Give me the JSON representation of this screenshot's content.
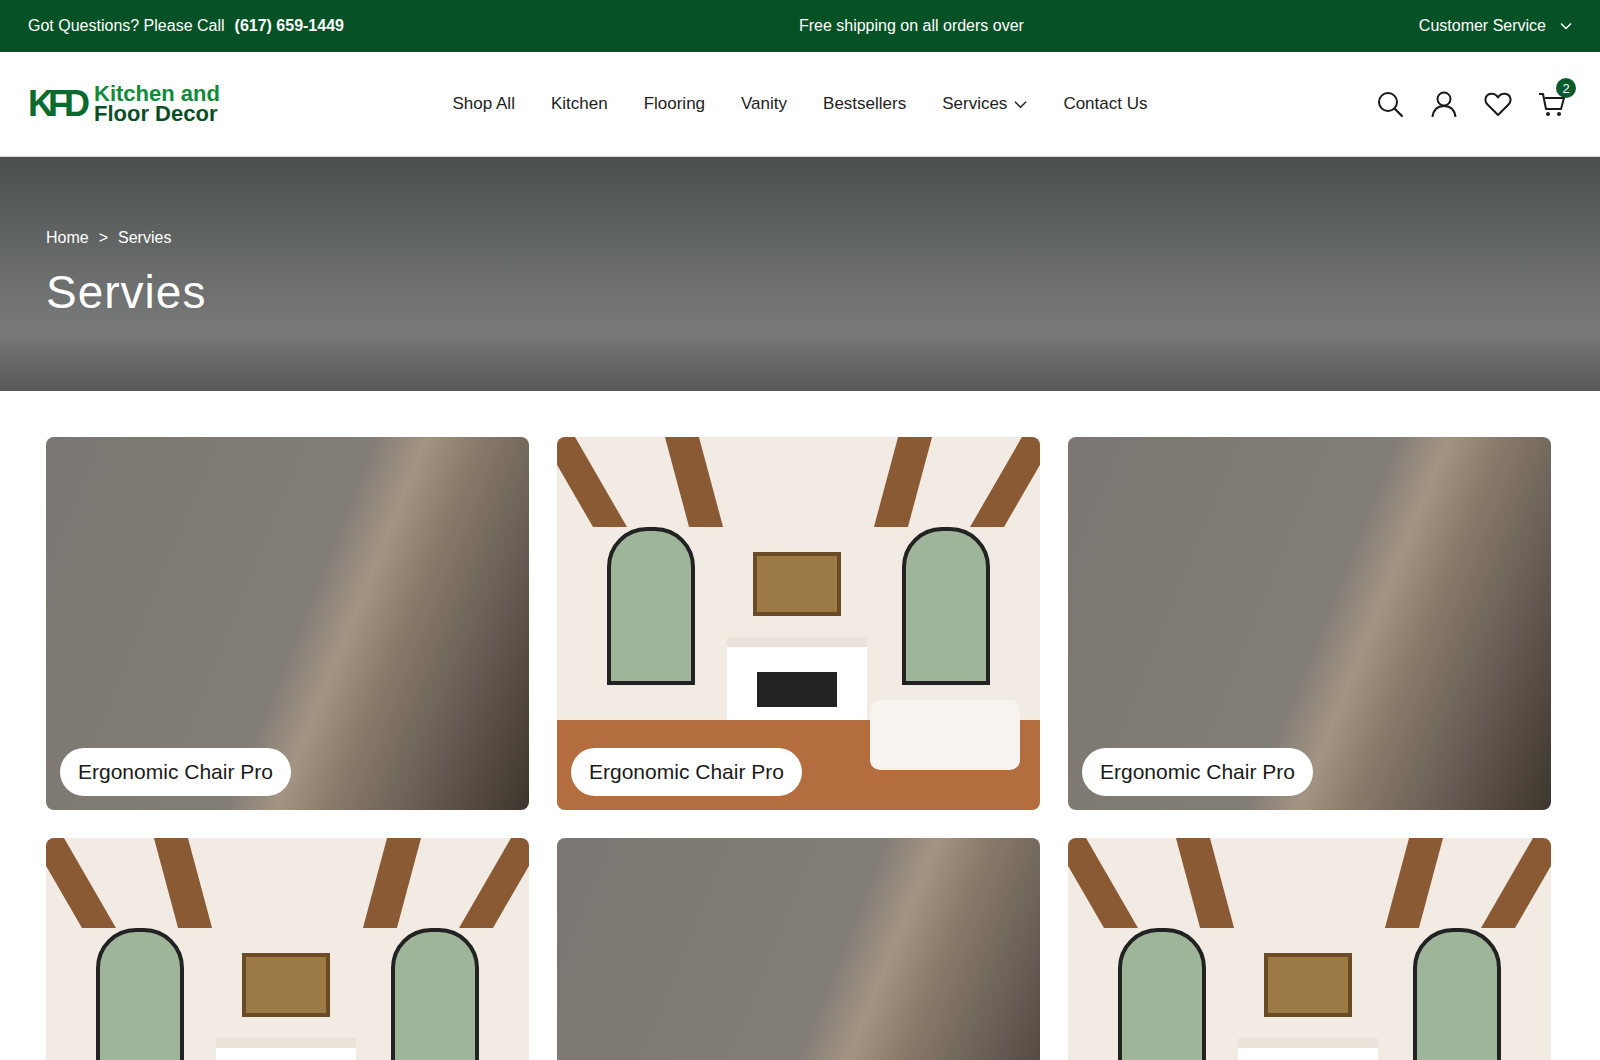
{
  "top_bar": {
    "phone_label": "Got Questions? Please Call",
    "phone": "(617) 659-1449",
    "promo": "Free shipping on all orders over",
    "customer_service": "Customer Service"
  },
  "logo": {
    "mark": "KFD",
    "line1": "Kitchen and",
    "line2": "Floor Decor"
  },
  "nav": [
    {
      "label": "Shop All",
      "dropdown": false
    },
    {
      "label": "Kitchen",
      "dropdown": false
    },
    {
      "label": "Flooring",
      "dropdown": false
    },
    {
      "label": "Vanity",
      "dropdown": false
    },
    {
      "label": "Bestsellers",
      "dropdown": false
    },
    {
      "label": "Services",
      "dropdown": true
    },
    {
      "label": "Contact Us",
      "dropdown": false
    }
  ],
  "cart": {
    "count": "2"
  },
  "hero": {
    "breadcrumb": [
      "Home",
      "Servies"
    ],
    "separator": ">",
    "title": "Servies"
  },
  "cards": [
    {
      "kind": "fabric",
      "label": "Ergonomic Chair Pro"
    },
    {
      "kind": "room",
      "label": "Ergonomic Chair Pro"
    },
    {
      "kind": "fabric",
      "label": "Ergonomic Chair Pro"
    },
    {
      "kind": "room"
    },
    {
      "kind": "fabric"
    },
    {
      "kind": "room"
    }
  ]
}
